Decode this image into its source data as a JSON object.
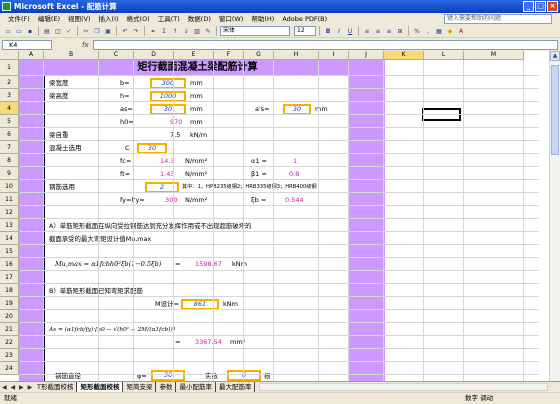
{
  "window": {
    "title": "Microsoft Excel - 配筋计算"
  },
  "menu": {
    "items": [
      "文件(F)",
      "编辑(E)",
      "视图(V)",
      "插入(I)",
      "格式(O)",
      "工具(T)",
      "数据(D)",
      "窗口(W)",
      "帮助(H)",
      "Adobe PDF(B)"
    ],
    "help_placeholder": "键入需要帮助的问题"
  },
  "toolbar": {
    "font_name": "宋体",
    "font_size": "12"
  },
  "formula": {
    "name_box": "K4",
    "fx": "fx"
  },
  "columns": [
    "A",
    "B",
    "C",
    "D",
    "E",
    "F",
    "G",
    "H",
    "I",
    "J",
    "K",
    "L",
    "M"
  ],
  "selected_column": "K",
  "rows": [
    "1",
    "2",
    "3",
    "4",
    "5",
    "6",
    "7",
    "8",
    "9",
    "10",
    "11",
    "12",
    "13",
    "14",
    "15",
    "16",
    "17",
    "18",
    "19",
    "20",
    "21",
    "22",
    "23",
    "24"
  ],
  "selected_row": "4",
  "sheet": {
    "title": "矩行截面混凝土梁配筋计算",
    "r2": {
      "label": "梁宽度",
      "sym": "b=",
      "val": "300",
      "unit": "mm"
    },
    "r3": {
      "label": "梁高度",
      "sym": "h=",
      "val": "1000",
      "unit": "mm"
    },
    "r4": {
      "sym": "as=",
      "val": "30",
      "unit": "mm",
      "sym2": "a's=",
      "val2": "30",
      "unit2": "mm"
    },
    "r5": {
      "sym": "h0=",
      "val": "970",
      "unit": "mm"
    },
    "r6": {
      "label": "梁自重",
      "val": "7.5",
      "unit": "kN/m"
    },
    "r7": {
      "label": "混凝土选用",
      "sym": "C",
      "val": "30"
    },
    "r8": {
      "sym": "fc=",
      "val": "14.3",
      "unit": "N/mm²",
      "sym2": "α1 =",
      "val2": "1"
    },
    "r9": {
      "sym": "ft=",
      "val": "1.43",
      "unit": "N/mm²",
      "sym2": "β1 =",
      "val2": "0.8"
    },
    "r10": {
      "label": "钢筋选用",
      "val": "2",
      "note": "其中：1，HPB235级钢2；HRB335级钢3；HRB400级钢"
    },
    "r11": {
      "sym": "fy=f'y=",
      "val": "300",
      "unit": "N/mm²",
      "sym2": "ξb =",
      "val2": "0.544"
    },
    "r13": "A）单筋矩形截面在纵向受拉钢筋达到充分发挥作用或不出现超筋破坏的",
    "r14": "截面承受的最大弯矩设计值Mu,max",
    "r16": {
      "formula": "Mu,max = α1fcbh0²ξb(1−0.5ξb)",
      "eq": "=",
      "val": "1598.67",
      "unit": "kNm"
    },
    "r18": "B）单筋矩形截面已知弯矩求配筋",
    "r19": {
      "sym": "M设计=",
      "val": "861",
      "unit": "kNm"
    },
    "r21": {
      "formula": "As = (α1fcb/fy)·[h0 − √(h0² − 2M/(α1fcb))]",
      "eq": "=",
      "val": "3367.54",
      "unit": "mm²"
    },
    "r24": {
      "label": "钢筋直径",
      "sym": "φ=",
      "val": "36",
      "sym2": "实数",
      "val2": "6",
      "unit2": "根"
    }
  },
  "tabs": [
    "T形截面校核",
    "矩形截面校核",
    "矩简支梁",
    "参数",
    "最小配筋率",
    "最大配筋率"
  ],
  "tab_nav": "◀ ◀ ▶ ▶",
  "active_tab": 1,
  "status": {
    "left": "就绪",
    "right": "数字  调动"
  }
}
